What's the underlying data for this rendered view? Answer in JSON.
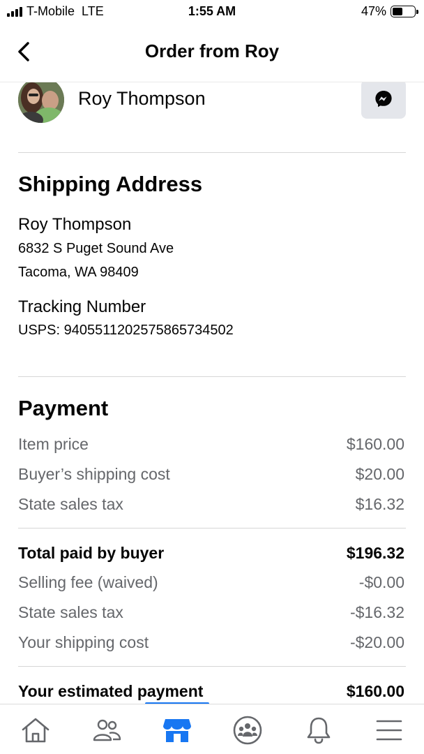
{
  "status_bar": {
    "carrier": "T-Mobile",
    "network": "LTE",
    "time": "1:55 AM",
    "battery": "47%",
    "battery_level": 0.47
  },
  "header": {
    "title": "Order from Roy",
    "back_icon": "chevron-left-icon"
  },
  "buyer": {
    "name": "Roy Thompson",
    "message_icon": "messenger-icon"
  },
  "shipping": {
    "heading": "Shipping Address",
    "name": "Roy Thompson",
    "street": "6832 S Puget Sound Ave",
    "city_line": "Tacoma, WA 98409",
    "tracking_heading": "Tracking Number",
    "tracking_value": "USPS: 9405511202575865734502"
  },
  "payment": {
    "heading": "Payment",
    "rows": [
      {
        "label": "Item price",
        "value": "$160.00",
        "bold": false
      },
      {
        "label": "Buyer’s shipping cost",
        "value": "$20.00",
        "bold": false
      },
      {
        "label": "State sales tax",
        "value": "$16.32",
        "bold": false
      },
      {
        "label": "Total paid by buyer",
        "value": "$196.32",
        "bold": true
      },
      {
        "label": "Selling fee (waived)",
        "value": "-$0.00",
        "bold": false
      },
      {
        "label": "State sales tax",
        "value": "-$16.32",
        "bold": false
      },
      {
        "label": "Your shipping cost",
        "value": "-$20.00",
        "bold": false
      },
      {
        "label": "Your estimated payment",
        "value": "$160.00",
        "bold": true
      }
    ]
  },
  "tab_bar": {
    "tabs": [
      {
        "icon": "home-icon",
        "active": false
      },
      {
        "icon": "friends-icon",
        "active": false
      },
      {
        "icon": "marketplace-icon",
        "active": true
      },
      {
        "icon": "groups-icon",
        "active": false
      },
      {
        "icon": "notifications-icon",
        "active": false
      },
      {
        "icon": "menu-icon",
        "active": false
      }
    ]
  },
  "colors": {
    "accent": "#1877f2",
    "secondary_text": "#65676b",
    "primary_text": "#050505",
    "button_bg": "#e4e6eb"
  }
}
